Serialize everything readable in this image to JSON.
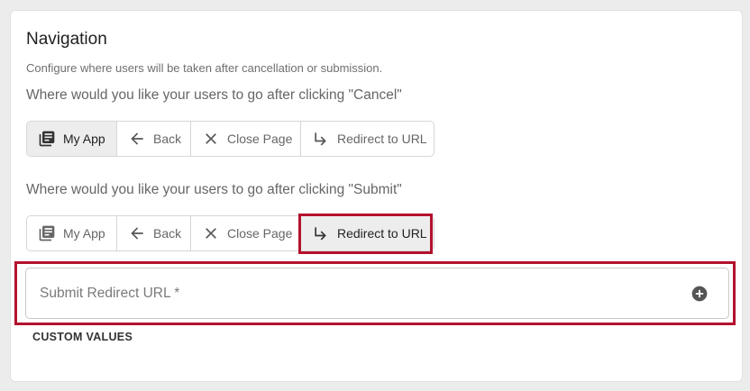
{
  "section": {
    "title": "Navigation",
    "description": "Configure where users will be taken after cancellation or submission."
  },
  "cancel": {
    "question": "Where would you like your users to go after clicking \"Cancel\"",
    "options": [
      {
        "label": "My App",
        "icon": "library-books-icon",
        "selected": true
      },
      {
        "label": "Back",
        "icon": "arrow-left-icon",
        "selected": false
      },
      {
        "label": "Close Page",
        "icon": "close-icon",
        "selected": false
      },
      {
        "label": "Redirect to URL",
        "icon": "subdirectory-arrow-right-icon",
        "selected": false
      }
    ]
  },
  "submit": {
    "question": "Where would you like your users to go after clicking \"Submit\"",
    "options": [
      {
        "label": "My App",
        "icon": "library-books-icon",
        "selected": false
      },
      {
        "label": "Back",
        "icon": "arrow-left-icon",
        "selected": false
      },
      {
        "label": "Close Page",
        "icon": "close-icon",
        "selected": false
      },
      {
        "label": "Redirect to URL",
        "icon": "subdirectory-arrow-right-icon",
        "selected": true
      }
    ]
  },
  "redirect_field": {
    "placeholder": "Submit Redirect URL *",
    "value": "",
    "add_icon": "add-circle-icon"
  },
  "custom_values_label": "CUSTOM VALUES",
  "colors": {
    "highlight": "#b3122e",
    "selected_bg": "#ededed"
  }
}
